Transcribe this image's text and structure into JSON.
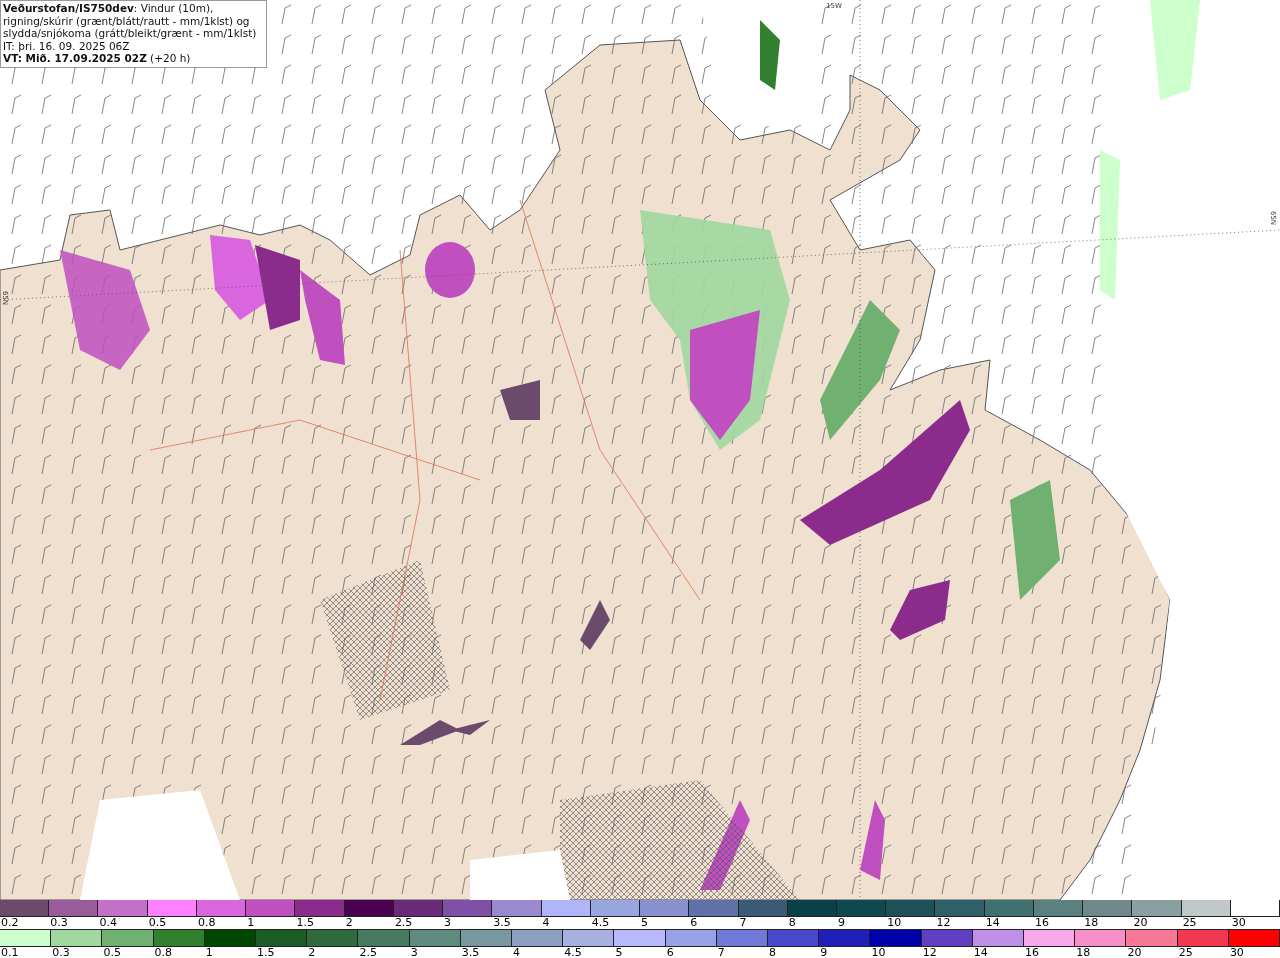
{
  "header": {
    "lines": [
      "**Veðurstofan/IS750dev**: Vindur (10m), rigning/skúrir (grænt/blátt/rautt - mm/1klst) og slydda/snjókoma (grátt/bleikt/grænt - mm/1klst)",
      "IT: þri. 16. 09. 2025 06Z",
      "**VT: Mið. 17.09.2025 02Z** (+20 h)"
    ]
  },
  "map": {
    "grid_labels": [
      {
        "kind": "top",
        "text": "15W"
      },
      {
        "kind": "right",
        "text": "65N"
      },
      {
        "kind": "left",
        "text": "65N"
      }
    ]
  },
  "legends": [
    {
      "segments": [
        {
          "label": "0.2",
          "color": "#6b4a6b"
        },
        {
          "label": "0.3",
          "color": "#9a5b9a"
        },
        {
          "label": "0.4",
          "color": "#c270c8"
        },
        {
          "label": "0.5",
          "color": "#ff80ff"
        },
        {
          "label": "0.8",
          "color": "#d966de"
        },
        {
          "label": "1",
          "color": "#c050c0"
        },
        {
          "label": "1.5",
          "color": "#8b2b8b"
        },
        {
          "label": "2",
          "color": "#4b0050"
        },
        {
          "label": "2.5",
          "color": "#6a2a7a"
        },
        {
          "label": "3",
          "color": "#8050a8"
        },
        {
          "label": "3.5",
          "color": "#9a88d0"
        },
        {
          "label": "4",
          "color": "#b0b4f8"
        },
        {
          "label": "4.5",
          "color": "#9aa6e0"
        },
        {
          "label": "5",
          "color": "#8890d0"
        },
        {
          "label": "6",
          "color": "#6070a8"
        },
        {
          "label": "7",
          "color": "#3a5a78"
        },
        {
          "label": "8",
          "color": "#0a4048"
        },
        {
          "label": "9",
          "color": "#104850"
        },
        {
          "label": "10",
          "color": "#1e5058"
        },
        {
          "label": "12",
          "color": "#2e6068"
        },
        {
          "label": "14",
          "color": "#407070"
        },
        {
          "label": "16",
          "color": "#5a8080"
        },
        {
          "label": "18",
          "color": "#708888"
        },
        {
          "label": "20",
          "color": "#8aa0a0"
        },
        {
          "label": "25",
          "color": "#c0c8cc"
        },
        {
          "label": "30",
          "color": "#ffffff"
        }
      ]
    },
    {
      "segments": [
        {
          "label": "0.1",
          "color": "#ccffcc"
        },
        {
          "label": "0.3",
          "color": "#a0d8a0"
        },
        {
          "label": "0.5",
          "color": "#70b070"
        },
        {
          "label": "0.8",
          "color": "#308030"
        },
        {
          "label": "1",
          "color": "#004800"
        },
        {
          "label": "1.5",
          "color": "#1a5c24"
        },
        {
          "label": "2",
          "color": "#2e6a3e"
        },
        {
          "label": "2.5",
          "color": "#467a5e"
        },
        {
          "label": "3",
          "color": "#5e8a80"
        },
        {
          "label": "3.5",
          "color": "#7898a0"
        },
        {
          "label": "4",
          "color": "#8ea0c0"
        },
        {
          "label": "4.5",
          "color": "#a8b0e0"
        },
        {
          "label": "5",
          "color": "#b8b8ff"
        },
        {
          "label": "6",
          "color": "#98a0e8"
        },
        {
          "label": "7",
          "color": "#7078d8"
        },
        {
          "label": "8",
          "color": "#4848c8"
        },
        {
          "label": "9",
          "color": "#2020b8"
        },
        {
          "label": "10",
          "color": "#0000a8"
        },
        {
          "label": "12",
          "color": "#6040c0"
        },
        {
          "label": "14",
          "color": "#c090e8"
        },
        {
          "label": "16",
          "color": "#f8a8e8"
        },
        {
          "label": "18",
          "color": "#f890c8"
        },
        {
          "label": "20",
          "color": "#f87898"
        },
        {
          "label": "25",
          "color": "#f03850"
        },
        {
          "label": "30",
          "color": "#ff0000"
        }
      ]
    }
  ]
}
